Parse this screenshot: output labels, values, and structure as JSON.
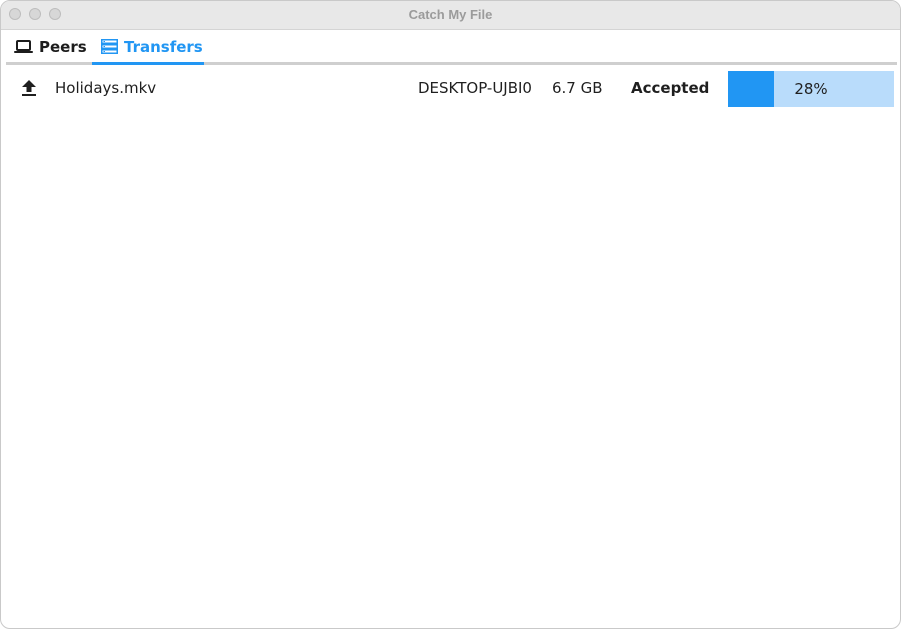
{
  "window": {
    "title": "Catch My File"
  },
  "tabs": [
    {
      "label": "Peers",
      "icon": "laptop-icon",
      "active": false
    },
    {
      "label": "Transfers",
      "icon": "list-icon",
      "active": true
    }
  ],
  "colors": {
    "accent": "#2196f3",
    "progress_track": "#b9dcfb"
  },
  "transfers": [
    {
      "direction_icon": "upload-icon",
      "filename": "Holidays.mkv",
      "peer": "DESKTOP-UJBI0",
      "size": "6.7 GB",
      "status": "Accepted",
      "progress_label": "28%",
      "progress": 0.28
    }
  ]
}
